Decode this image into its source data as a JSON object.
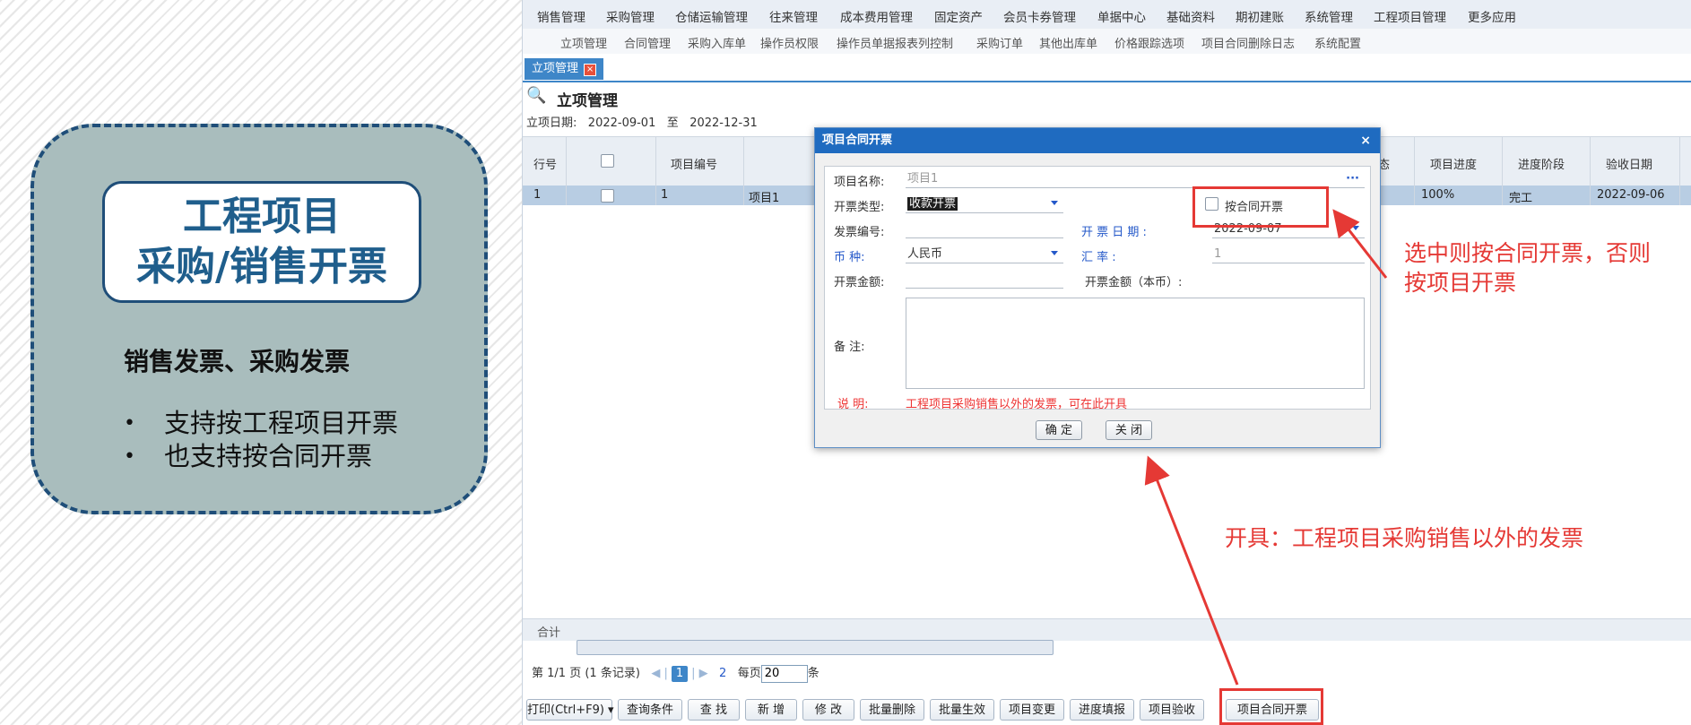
{
  "promo": {
    "title_line1": "工程项目",
    "title_line2": "采购/销售开票",
    "subtitle": "销售发票、采购发票",
    "bullets": [
      "支持按工程项目开票",
      "也支持按合同开票"
    ]
  },
  "menu": [
    "销售管理",
    "采购管理",
    "仓储运输管理",
    "往来管理",
    "成本费用管理",
    "固定资产",
    "会员卡券管理",
    "单据中心",
    "基础资料",
    "期初建账",
    "系统管理",
    "工程项目管理",
    "更多应用"
  ],
  "submenu": [
    "立项管理",
    "合同管理",
    "采购入库单",
    "操作员权限",
    "操作员单据报表列控制",
    "采购订单",
    "其他出库单",
    "价格跟踪选项",
    "项目合同删除日志",
    "系统配置"
  ],
  "tab": {
    "label": "立项管理",
    "close": "×"
  },
  "page": {
    "title": "立项管理",
    "date_label": "立项日期:",
    "date_from": "2022-09-01",
    "date_sep": "至",
    "date_to": "2022-12-31"
  },
  "grid": {
    "headers": {
      "row_no": "行号",
      "code": "项目编号",
      "status_tail": "态",
      "progress": "项目进度",
      "stage": "进度阶段",
      "accept_date": "验收日期"
    },
    "row": {
      "row_no": "1",
      "code": "1",
      "name": "项目1",
      "progress": "100%",
      "stage": "完工",
      "accept_date": "2022-09-06"
    },
    "footer": "合计"
  },
  "pager": {
    "prefix": "第",
    "page_info": "1/1",
    "records": "页 (1 条记录)",
    "current": "1",
    "last": "2",
    "per_page_label": "每页",
    "per_page_value": "20",
    "unit": "条"
  },
  "buttons": [
    "打印(Ctrl+F9) ▾",
    "查询条件",
    "查 找",
    "新 增",
    "修 改",
    "批量删除",
    "批量生效",
    "项目变更",
    "进度填报",
    "项目验收",
    "项目合同开票"
  ],
  "dialog": {
    "title": "项目合同开票",
    "close": "×",
    "project_name_label": "项目名称:",
    "project_name_value": "项目1",
    "lookup": "···",
    "invoice_type_label": "开票类型:",
    "invoice_type_value": "收款开票",
    "by_contract_label": "按合同开票",
    "invoice_no_label": "发票编号:",
    "invoice_date_label": "开 票 日 期 :",
    "invoice_date_value": "2022-09-07",
    "currency_label": "币    种:",
    "currency_value": "人民币",
    "rate_label": "汇      率    :",
    "rate_value": "1",
    "amount_label": "开票金额:",
    "amount_local_label": "开票金额（本币）:",
    "remark_label": "备    注:",
    "note_label": "说    明:",
    "note_text": "工程项目采购销售以外的发票，可在此开具",
    "ok": "确 定",
    "close_btn": "关 闭"
  },
  "annotations": {
    "checkbox_note_line1": "选中则按合同开票，否则",
    "checkbox_note_line2": "按项目开票",
    "issue_note": "开具：工程项目采购销售以外的发票"
  },
  "colors": {
    "accent": "#1f6bc0",
    "annotation": "#e53935",
    "card_bg": "#a9bdbd",
    "card_border": "#1f4e79"
  }
}
